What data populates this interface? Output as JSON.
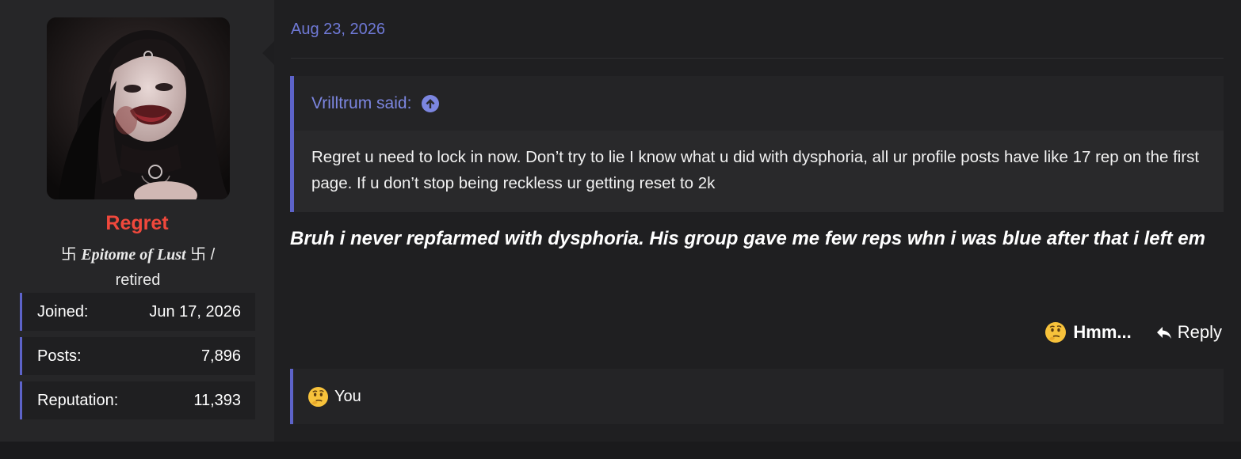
{
  "user": {
    "name": "Regret",
    "title_symbol": "卐",
    "title_fancy": "Epitome of Lust",
    "title_separator": "/",
    "title_status": "retired",
    "stats": [
      {
        "label": "Joined:",
        "value": "Jun 17, 2026"
      },
      {
        "label": "Posts:",
        "value": "7,896"
      },
      {
        "label": "Reputation:",
        "value": "11,393"
      }
    ],
    "name_color": "#f0483c"
  },
  "post": {
    "date": "Aug 23, 2026",
    "quote": {
      "author_said": "Vrilltrum said:",
      "body": "Regret u need to lock in now. Don’t try to lie I know what u did with dysphoria, all ur profile posts have like 17 rep on the first page. If u don’t stop being reckless ur getting reset to 2k"
    },
    "message": "Bruh i never repfarmed with dysphoria. His group gave me few reps whn i was blue after that i left em",
    "actions": {
      "react_label": "Hmm...",
      "reply_label": "Reply"
    },
    "reactions": {
      "label": "You",
      "icon": "thinking-face-icon"
    }
  },
  "colors": {
    "accent": "#5d63c9",
    "link": "#6f79d6"
  }
}
